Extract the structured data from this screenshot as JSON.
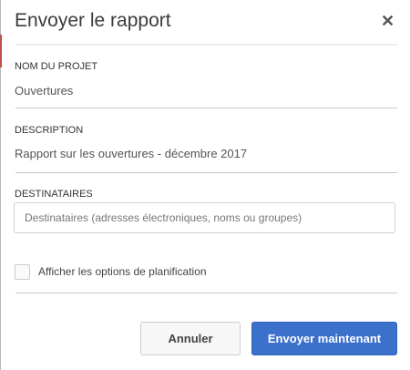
{
  "dialog": {
    "title": "Envoyer le rapport",
    "close_icon": "close-icon"
  },
  "fields": {
    "project_label": "NOM DU PROJET",
    "project_value": "Ouvertures",
    "description_label": "DESCRIPTION",
    "description_value": "Rapport sur les ouvertures - décembre 2017",
    "recipients_label": "DESTINATAIRES",
    "recipients_placeholder": "Destinataires (adresses électroniques, noms ou groupes)",
    "recipients_value": ""
  },
  "options": {
    "schedule_label": "Afficher les options de planification",
    "schedule_checked": false
  },
  "buttons": {
    "cancel": "Annuler",
    "send": "Envoyer maintenant"
  },
  "colors": {
    "primary": "#3b70cb"
  }
}
